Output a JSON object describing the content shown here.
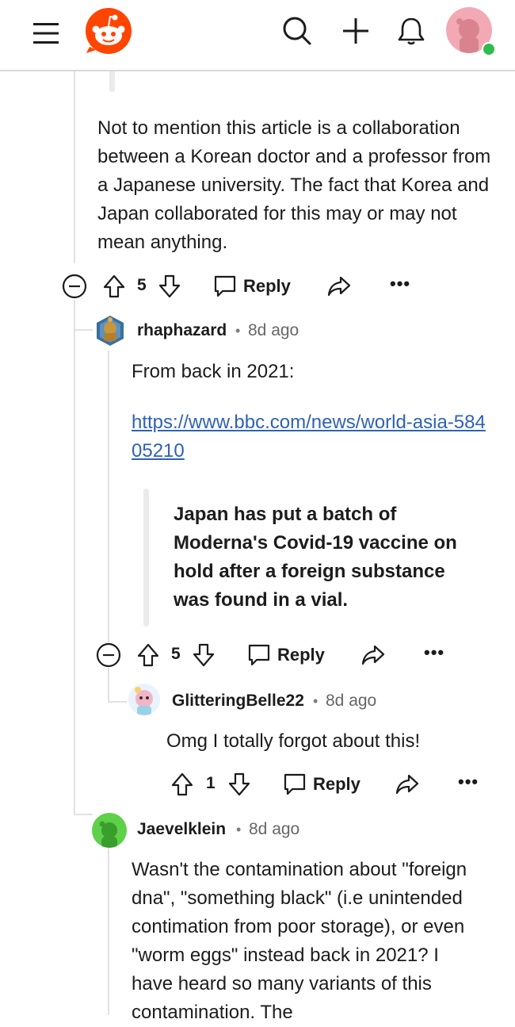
{
  "comments": [
    {
      "paragraph": "Not to mention this article is a collaboration between a Korean doctor and a professor from a Japanese university. The fact that Korea and Japan collaborated for this may or may not mean anything.",
      "votes": "5",
      "reply_label": "Reply"
    },
    {
      "author": "rhaphazard",
      "sep": "•",
      "time": "8d ago",
      "intro": "From back in 2021:",
      "link": "https://www.bbc.com/news/world-asia-58405210",
      "quote": "Japan has put a batch of Moderna's Covid-19 vaccine on hold after a foreign substance was found in a vial.",
      "votes": "5",
      "reply_label": "Reply"
    },
    {
      "author": "GlitteringBelle22",
      "sep": "•",
      "time": "8d ago",
      "text": "Omg I totally forgot about this!",
      "votes": "1",
      "reply_label": "Reply"
    },
    {
      "author": "Jaevelklein",
      "sep": "•",
      "time": "8d ago",
      "text": "Wasn't the contamination about \"foreign dna\", \"something black\" (i.e unintended contimation from poor storage), or even \"worm eggs\" instead back in 2021? I have heard so many variants of this contamination. The"
    }
  ],
  "more_label": "•••",
  "colors": {
    "brand": "#ff4500",
    "link": "#2f62b4",
    "online": "#2dbd4e"
  },
  "icons": [
    "menu-icon",
    "reddit-logo",
    "search-icon",
    "plus-icon",
    "bell-icon",
    "profile-avatar",
    "collapse-icon",
    "upvote-icon",
    "downvote-icon",
    "comment-icon",
    "share-icon",
    "more-icon"
  ]
}
